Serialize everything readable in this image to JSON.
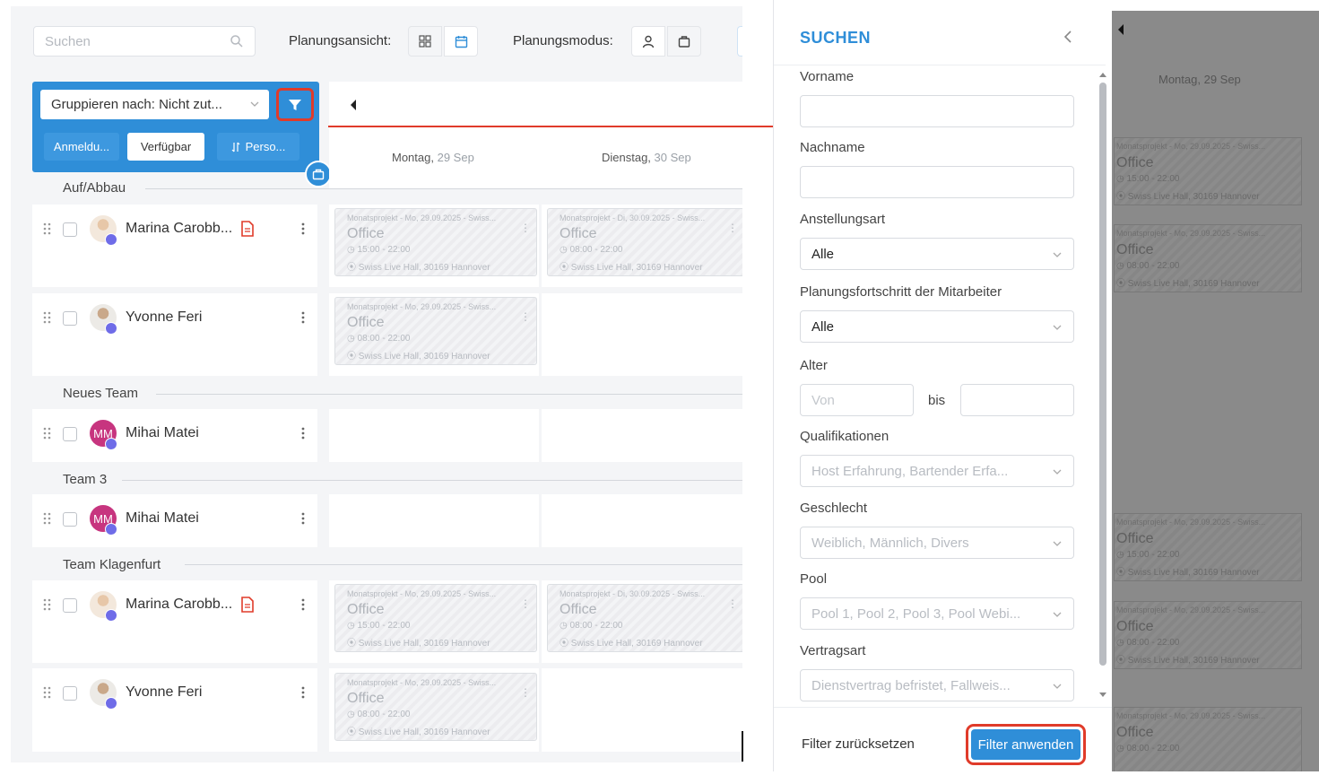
{
  "toolbar": {
    "search_placeholder": "Suchen",
    "view_label": "Planungsansicht:",
    "mode_label": "Planungsmodus:"
  },
  "grouping": {
    "group_by_label": "Gruppieren nach: Nicht zut...",
    "tabs": [
      "Anmeldu...",
      "Verfügbar",
      "Perso..."
    ]
  },
  "calendar": {
    "days": [
      {
        "day": "Montag,",
        "date": "29 Sep"
      },
      {
        "day": "Dienstag,",
        "date": "30 Sep"
      }
    ]
  },
  "sections": [
    "Auf/Abbau",
    "Neues Team",
    "Team 3",
    "Team Klagenfurt"
  ],
  "employees": [
    {
      "name": "Marina Carobb...",
      "initials": ""
    },
    {
      "name": "Yvonne Feri",
      "initials": ""
    },
    {
      "name": "Mihai Matei",
      "initials": "MM"
    },
    {
      "name": "Mihai Matei",
      "initials": "MM"
    },
    {
      "name": "Marina Carobb...",
      "initials": ""
    },
    {
      "name": "Yvonne Feri",
      "initials": ""
    }
  ],
  "shifts": {
    "mon_early": {
      "header": "Monatsprojekt - Mo, 29.09.2025 - Swiss...",
      "role": "Office",
      "time": "15:00 - 22:00",
      "location": "Swiss Live Hall, 30169 Hannover"
    },
    "tue": {
      "header": "Monatsprojekt - Di, 30.09.2025 - Swiss...",
      "role": "Office",
      "time": "08:00 - 22:00",
      "location": "Swiss Live Hall, 30169 Hannover"
    },
    "mon_late": {
      "header": "Monatsprojekt - Mo, 29.09.2025 - Swiss...",
      "role": "Office",
      "time": "08:00 - 22:00",
      "location": "Swiss Live Hall, 30169 Hannover"
    }
  },
  "panel": {
    "title": "SUCHEN",
    "fields": {
      "first_name": "Vorname",
      "last_name": "Nachname",
      "employment_type": "Anstellungsart",
      "employment_type_value": "Alle",
      "progress": "Planungsfortschritt der Mitarbeiter",
      "progress_value": "Alle",
      "age": "Alter",
      "age_from_placeholder": "Von",
      "age_to": "bis",
      "qualifications": "Qualifikationen",
      "qualifications_value": "Host Erfahrung, Bartender Erfa...",
      "gender": "Geschlecht",
      "gender_value": "Weiblich, Männlich, Divers",
      "pool": "Pool",
      "pool_value": "Pool 1, Pool 2, Pool 3, Pool Webi...",
      "contract": "Vertragsart",
      "contract_value": "Dienstvertrag befristet, Fallweis..."
    },
    "reset_label": "Filter zurücksetzen",
    "apply_label": "Filter anwenden"
  },
  "background": {
    "day_header": "Montag, 29 Sep"
  },
  "colors": {
    "accent": "#2f8ed8",
    "highlight": "#e03b2a",
    "avatar_mm": "#c7357f",
    "badge": "#6f6ce8"
  }
}
